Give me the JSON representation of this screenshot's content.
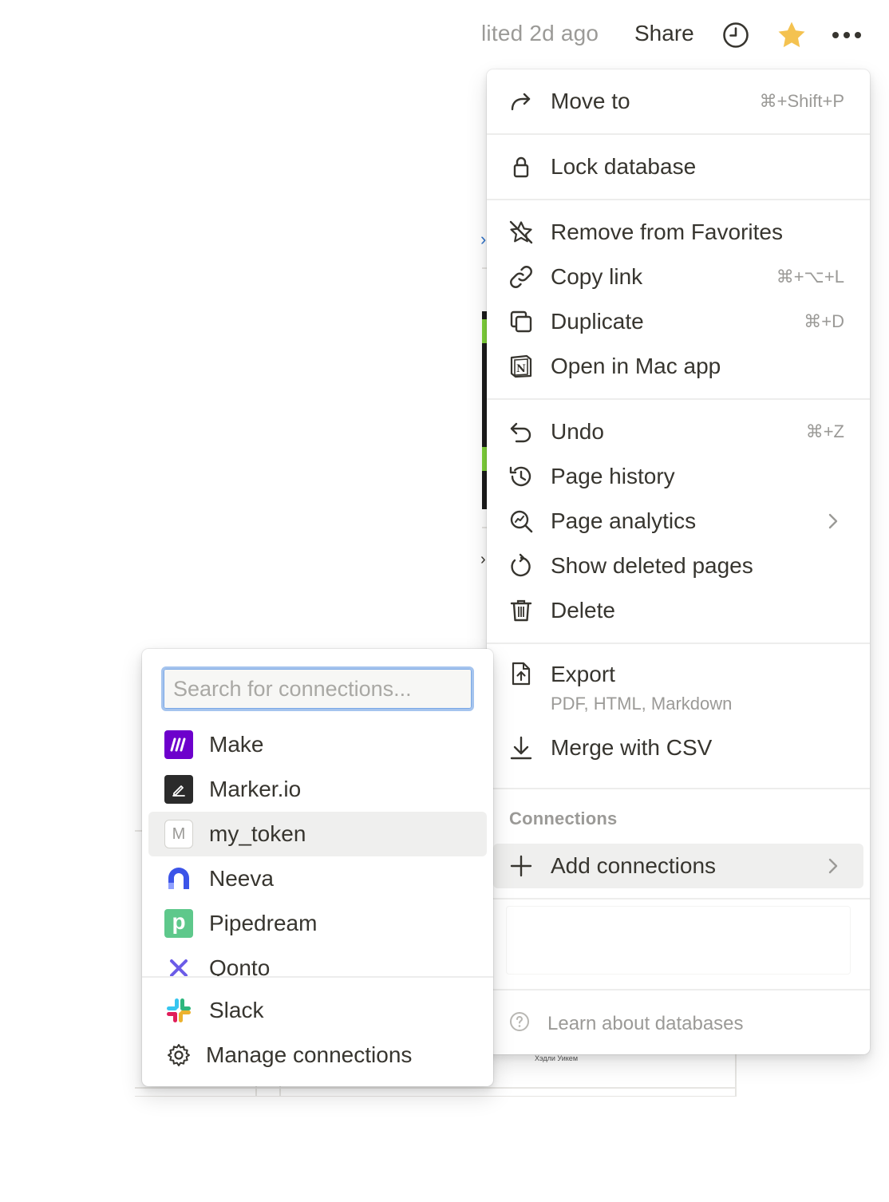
{
  "topbar": {
    "edited_text": "lited 2d ago",
    "share_label": "Share",
    "clock_icon": "clock-icon",
    "favorite_icon": "star-icon",
    "favorite_color": "#f4c250",
    "more_icon": "more-horizontal-icon"
  },
  "menu": {
    "items": [
      {
        "label": "Move to",
        "shortcut": "⌘+Shift+P",
        "icon": "arrow-turn-right-icon"
      },
      {
        "label": "Lock database",
        "icon": "lock-icon"
      },
      {
        "label": "Remove from Favorites",
        "icon": "star-slash-icon"
      },
      {
        "label": "Copy link",
        "shortcut": "⌘+⌥+L",
        "icon": "link-icon"
      },
      {
        "label": "Duplicate",
        "shortcut": "⌘+D",
        "icon": "duplicate-icon"
      },
      {
        "label": "Open in Mac app",
        "icon": "notion-app-icon"
      },
      {
        "label": "Undo",
        "shortcut": "⌘+Z",
        "icon": "undo-icon"
      },
      {
        "label": "Page history",
        "icon": "history-icon"
      },
      {
        "label": "Page analytics",
        "icon": "analytics-search-icon"
      },
      {
        "label": "Show deleted pages",
        "icon": "restore-icon"
      },
      {
        "label": "Delete",
        "icon": "trash-icon"
      },
      {
        "label": "Export",
        "sublabel": "PDF, HTML, Markdown",
        "icon": "export-file-icon"
      },
      {
        "label": "Merge with CSV",
        "icon": "download-arrow-icon"
      }
    ],
    "connections_header": "Connections",
    "add_connections_label": "Add connections",
    "learn_label": "Learn about databases"
  },
  "connections_submenu": {
    "search_placeholder": "Search for connections...",
    "items": [
      {
        "label": "Make",
        "icon": "make-logo-icon",
        "color": "#6d00cc"
      },
      {
        "label": "Marker.io",
        "icon": "marker-io-logo-icon",
        "color": "#2b2b2b"
      },
      {
        "label": "my_token",
        "icon": "letter-m-icon",
        "initial": "M",
        "highlighted": true
      },
      {
        "label": "Neeva",
        "icon": "neeva-logo-icon",
        "color": "#3c54e8"
      },
      {
        "label": "Pipedream",
        "icon": "pipedream-logo-icon",
        "initial": "p",
        "color": "#5ec88b"
      },
      {
        "label": "Qonto",
        "icon": "qonto-logo-icon",
        "color": "#6b5ce7"
      }
    ],
    "slack_label": "Slack",
    "manage_label": "Manage connections"
  }
}
